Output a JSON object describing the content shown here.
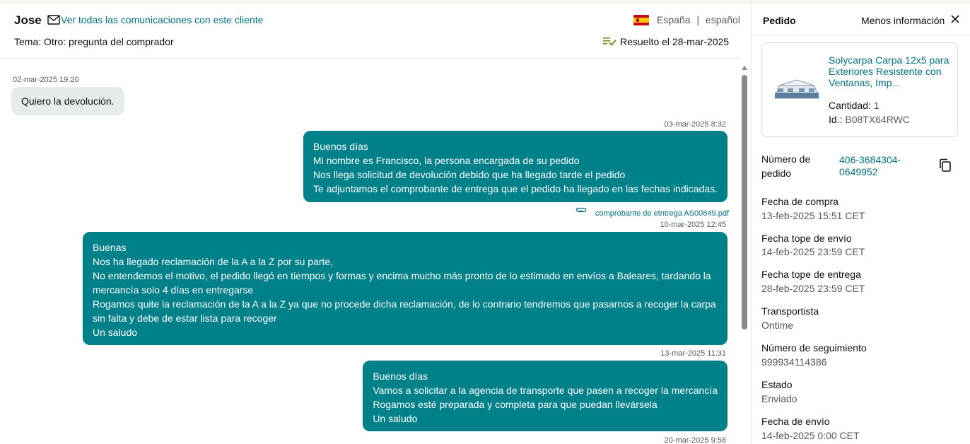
{
  "conversation": {
    "customer_name": "Jose",
    "all_comms_link": "Ver todas las comunicaciones con este cliente",
    "country": "España",
    "separator": "|",
    "language": "español",
    "topic": "Tema: Otro: pregunta del comprador",
    "resolved": "Resuelto el 28-mar-2025"
  },
  "messages": [
    {
      "timestamp": "02-mar-2025 19:20",
      "direction": "in",
      "lines": [
        "Quiero la devolución."
      ]
    },
    {
      "timestamp": "03-mar-2025 8:32",
      "direction": "out",
      "lines": [
        "Buenos días",
        "Mi nombre es Francisco, la persona encargada de su pedido",
        "Nos llega solicitud de devolución debido que ha llegado tarde el pedido",
        "Te adjuntamos el comprobante de entrega que el pedido ha llegado en las fechas indicadas."
      ],
      "attachment": "comprobante de etntrega AS00849.pdf"
    },
    {
      "timestamp": "10-mar-2025 12:45",
      "direction": "out",
      "lines": [
        "Buenas",
        "Nos ha llegado reclamación de la A a la Z por su parte,",
        "No entendemos el motivo, el pedido llegó en tiempos y formas y encima mucho más pronto de lo estimado en envíos a Baleares, tardando la mercancía solo 4 días en entregarse",
        "Rogamos quite la reclamación de la A a la Z ya que no procede dicha reclamación, de lo contrario tendremos que pasarnos a recoger la carpa sin falta y debe de estar lista para recoger",
        "Un saludo"
      ]
    },
    {
      "timestamp": "13-mar-2025 11:31",
      "direction": "out",
      "lines": [
        "Buenos días",
        "Vamos a solicitar a la agencia de transporte que pasen a recoger la mercancía",
        "Rogamos esté preparada y completa para que puedan llevársela",
        "Un saludo"
      ]
    },
    {
      "timestamp": "20-mar-2025 9:58",
      "direction": "out",
      "lines": []
    }
  ],
  "order_panel": {
    "title": "Pedido",
    "less_info": "Menos información",
    "product": {
      "title": "Solycarpa Carpa 12x5 para Exteriores Resistente con Ventanas, Imp...",
      "quantity_label": "Cantidad:",
      "quantity": "1",
      "id_label": "Id.:",
      "id": "B08TX64RWC"
    },
    "order_number_label": "Número de pedido",
    "order_number": "406-3684304-0649952",
    "fields": [
      {
        "label": "Fecha de compra",
        "value": "13-feb-2025 15:51 CET"
      },
      {
        "label": "Fecha tope de envío",
        "value": "14-feb-2025 23:59 CET"
      },
      {
        "label": "Fecha tope de entrega",
        "value": "28-feb-2025 23:59 CET"
      },
      {
        "label": "Transportista",
        "value": "Ontime"
      },
      {
        "label": "Número de seguimiento",
        "value": "999934114386"
      },
      {
        "label": "Estado",
        "value": "Enviado"
      },
      {
        "label": "Fecha de envío",
        "value": "14-feb-2025 0:00 CET"
      }
    ]
  },
  "colors": {
    "outgoing_bubble": "#00818a",
    "incoming_bubble": "#e6ecee",
    "link": "#007185",
    "muted_text": "#565959"
  },
  "icons": [
    "mail-icon",
    "spain-flag-icon",
    "resolved-check-icon",
    "paperclip-icon",
    "close-icon",
    "copy-icon"
  ]
}
